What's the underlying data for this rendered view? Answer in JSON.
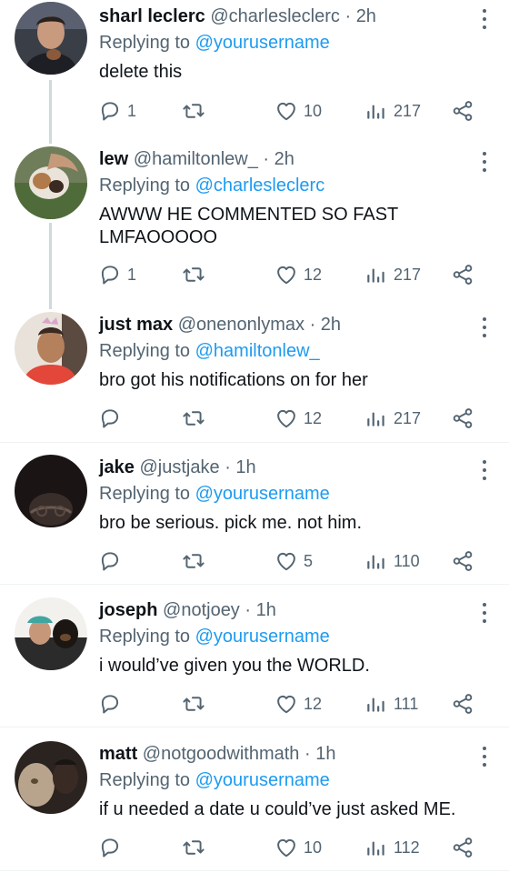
{
  "icons": {
    "reply": "reply-icon",
    "retweet": "retweet-icon",
    "like": "heart-icon",
    "views": "views-icon",
    "share": "share-icon",
    "more": "more-icon"
  },
  "colors": {
    "text": "#0f1419",
    "secondary": "#536471",
    "link": "#1d9bf0",
    "divider": "#eff3f4",
    "thread_line": "#cfd9de"
  },
  "tweets": [
    {
      "name": "sharl leclerc",
      "handle": "@charlesleclerc",
      "separator": "·",
      "time": "2h",
      "replying_prefix": "Replying to",
      "replying_to": "@yourusername",
      "text": "delete this",
      "replies": "1",
      "likes": "10",
      "views": "217"
    },
    {
      "name": "lew",
      "handle": "@hamiltonlew_",
      "separator": "·",
      "time": "2h",
      "replying_prefix": "Replying to",
      "replying_to": "@charlesleclerc",
      "text": "AWWW HE COMMENTED SO FAST LMFAOOOOO",
      "replies": "1",
      "likes": "12",
      "views": "217"
    },
    {
      "name": "just max",
      "handle": "@onenonlymax",
      "separator": "·",
      "time": "2h",
      "replying_prefix": "Replying to",
      "replying_to": "@hamiltonlew_",
      "text": "bro got his notifications on for her",
      "replies": "",
      "likes": "12",
      "views": "217"
    },
    {
      "name": "jake",
      "handle": "@justjake",
      "separator": "·",
      "time": "1h",
      "replying_prefix": "Replying to",
      "replying_to": "@yourusername",
      "text": "bro be serious. pick me. not him.",
      "replies": "",
      "likes": "5",
      "views": "110"
    },
    {
      "name": "joseph",
      "handle": "@notjoey",
      "separator": "·",
      "time": "1h",
      "replying_prefix": "Replying to",
      "replying_to": "@yourusername",
      "text": "i would’ve given you the WORLD.",
      "replies": "",
      "likes": "12",
      "views": "111"
    },
    {
      "name": "matt",
      "handle": "@notgoodwithmath",
      "separator": "·",
      "time": "1h",
      "replying_prefix": "Replying to",
      "replying_to": "@yourusername",
      "text": "if u needed a date u could’ve just asked ME.",
      "replies": "",
      "likes": "10",
      "views": "112"
    }
  ]
}
